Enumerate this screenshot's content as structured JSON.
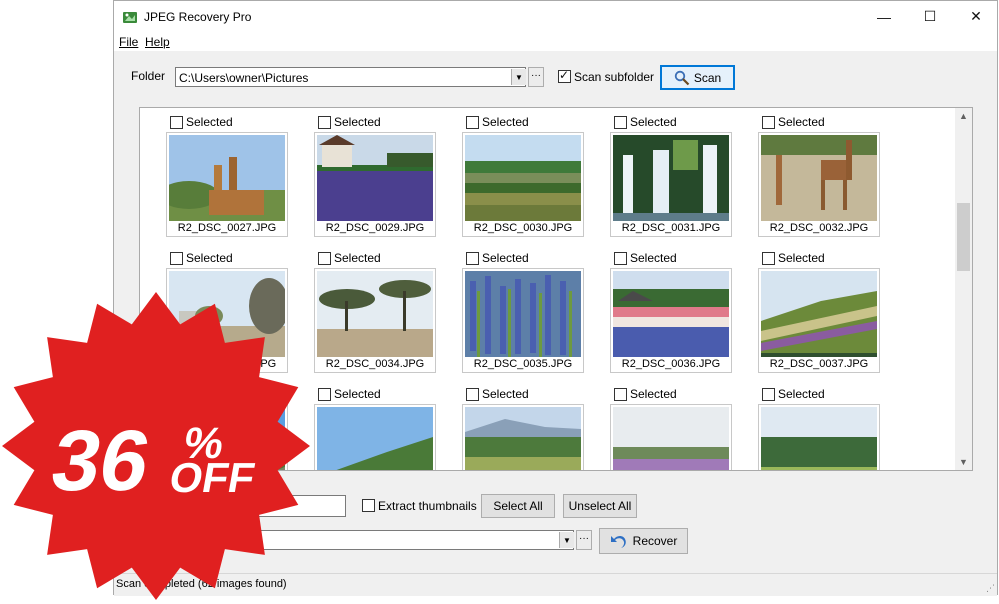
{
  "window": {
    "title": "JPEG Recovery Pro",
    "controls": {
      "minimize": "—",
      "maximize": "☐",
      "close": "✕"
    }
  },
  "menu": {
    "file": "File",
    "help": "Help"
  },
  "toolbar": {
    "folder_label": "Folder",
    "folder_path": "C:\\Users\\owner\\Pictures",
    "ellipsis": "···",
    "scan_subfolder_label": "Scan subfolder",
    "scan_subfolder_checked": true,
    "scan_button": "Scan"
  },
  "gallery": {
    "selected_label": "Selected",
    "thumbnails": [
      {
        "filename": "R2_DSC_0027.JPG",
        "scene": "giraffes-sky"
      },
      {
        "filename": "R2_DSC_0029.JPG",
        "scene": "lavender-house"
      },
      {
        "filename": "R2_DSC_0030.JPG",
        "scene": "field-stripes"
      },
      {
        "filename": "R2_DSC_0031.JPG",
        "scene": "waterfall"
      },
      {
        "filename": "R2_DSC_0032.JPG",
        "scene": "giraffes-savanna"
      },
      {
        "filename": "R2_DSC_0033.JPG",
        "scene": "dry-trees"
      },
      {
        "filename": "R2_DSC_0034.JPG",
        "scene": "acacia"
      },
      {
        "filename": "R2_DSC_0035.JPG",
        "scene": "lavender-close"
      },
      {
        "filename": "R2_DSC_0036.JPG",
        "scene": "flower-field-barn"
      },
      {
        "filename": "R2_DSC_0037.JPG",
        "scene": "hill-stripes"
      },
      {
        "filename": "",
        "scene": "blue-sky"
      },
      {
        "filename": "",
        "scene": "hill-forest"
      },
      {
        "filename": "",
        "scene": "field-mountain"
      },
      {
        "filename": "",
        "scene": "flowers-haze"
      },
      {
        "filename": "",
        "scene": "trees-row"
      }
    ]
  },
  "bottom": {
    "extract_thumbnails_label": "Extract thumbnails",
    "select_all": "Select All",
    "unselect_all": "Unselect All",
    "recover": "Recover",
    "ellipsis": "···"
  },
  "status": "Scan completed (62 images found)",
  "promo": {
    "percent": "36",
    "percent_sign": "%",
    "off": "OFF"
  },
  "colors": {
    "accent": "#0078d7",
    "badge_red": "#e02020"
  }
}
